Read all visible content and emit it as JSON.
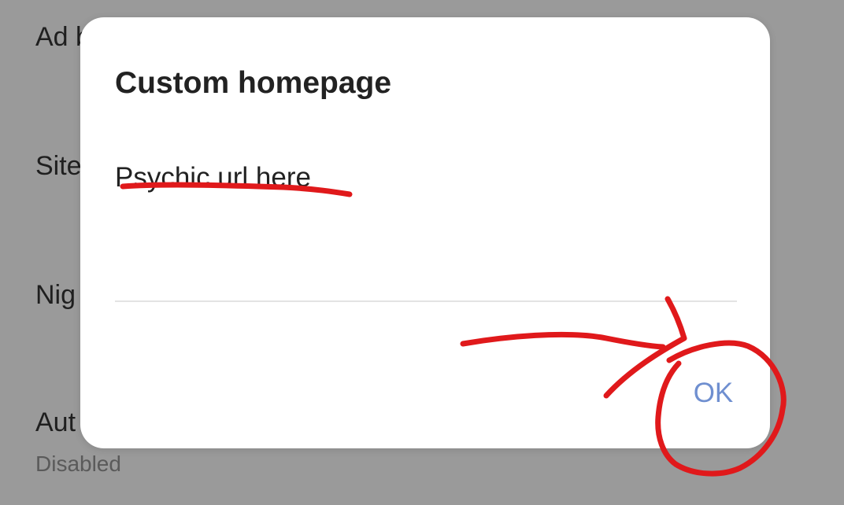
{
  "background_settings": {
    "items": [
      {
        "title": "Ad b"
      },
      {
        "title": "Site"
      },
      {
        "title": "Nig"
      },
      {
        "title": "Aut",
        "subtitle": "Disabled"
      }
    ]
  },
  "dialog": {
    "title": "Custom homepage",
    "input_value": "Psychic url here",
    "ok_label": "OK"
  },
  "colors": {
    "scrim": "#9a9a9a",
    "dialog_bg": "#ffffff",
    "accent_button": "#6f8fd0",
    "annotation_marker": "#e0191b"
  }
}
